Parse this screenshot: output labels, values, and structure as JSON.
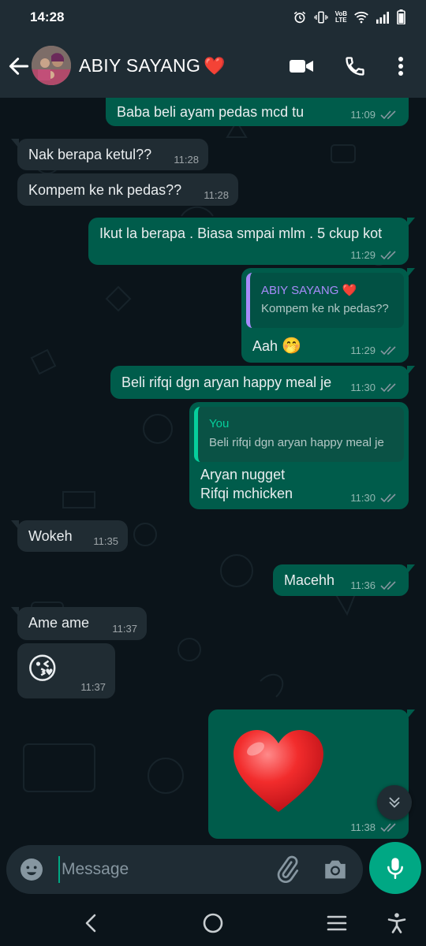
{
  "status_bar": {
    "time": "14:28",
    "volte_top": "VoB",
    "volte_bottom": "LTE",
    "icons": [
      "alarm-icon",
      "vibrate-icon",
      "volte-icon",
      "wifi-icon",
      "signal-icon",
      "battery-icon"
    ]
  },
  "header": {
    "contact_name": "ABIY SAYANG",
    "contact_emoji": "❤️",
    "icons": [
      "back-arrow-icon",
      "video-call-icon",
      "phone-icon",
      "more-vert-icon"
    ]
  },
  "messages": [
    {
      "dir": "out",
      "text": "Baba beli ayam pedas mcd tu",
      "time": "11:09",
      "status": "read"
    },
    {
      "dir": "in",
      "text": "Nak berapa ketul??",
      "time": "11:28"
    },
    {
      "dir": "in",
      "text": "Kompem ke nk pedas??",
      "time": "11:28"
    },
    {
      "dir": "out",
      "text": "Ikut la berapa . Biasa smpai mlm . 5 ckup kot",
      "time": "11:29",
      "status": "read"
    },
    {
      "dir": "out",
      "reply_to": {
        "name": "ABIY SAYANG",
        "emoji": "❤️",
        "text": "Kompem ke nk pedas??"
      },
      "text": "Aah",
      "emoji": "🤭",
      "time": "11:29",
      "status": "read"
    },
    {
      "dir": "out",
      "text": "Beli rifqi dgn aryan happy meal je",
      "time": "11:30",
      "status": "read"
    },
    {
      "dir": "out",
      "reply_to": {
        "name": "You",
        "text": "Beli rifqi dgn aryan happy meal je"
      },
      "lines": [
        "Aryan nugget",
        "Rifqi mchicken"
      ],
      "time": "11:30",
      "status": "read"
    },
    {
      "dir": "in",
      "text": "Wokeh",
      "time": "11:35"
    },
    {
      "dir": "out",
      "text": "Macehh",
      "time": "11:36",
      "status": "read"
    },
    {
      "dir": "in",
      "text": "Ame ame",
      "time": "11:37"
    },
    {
      "dir": "in",
      "emoji": "😘",
      "time": "11:37"
    },
    {
      "dir": "out",
      "emoji": "❤️",
      "time": "11:38",
      "status": "read"
    }
  ],
  "composer": {
    "placeholder": "Message",
    "icons": [
      "emoji-icon",
      "attach-icon",
      "camera-icon",
      "mic-icon"
    ]
  },
  "scroll_button": {
    "icon": "double-chevron-down-icon"
  },
  "nav_bar": {
    "icons": [
      "nav-back-icon",
      "nav-home-icon",
      "nav-recents-icon",
      "accessibility-icon"
    ]
  },
  "colors": {
    "header_bg": "#1f2c34",
    "chat_bg": "#0b141a",
    "incoming": "#202c33",
    "outgoing": "#005c4b",
    "accent": "#00a884",
    "read_ticks": "#8696a0"
  }
}
